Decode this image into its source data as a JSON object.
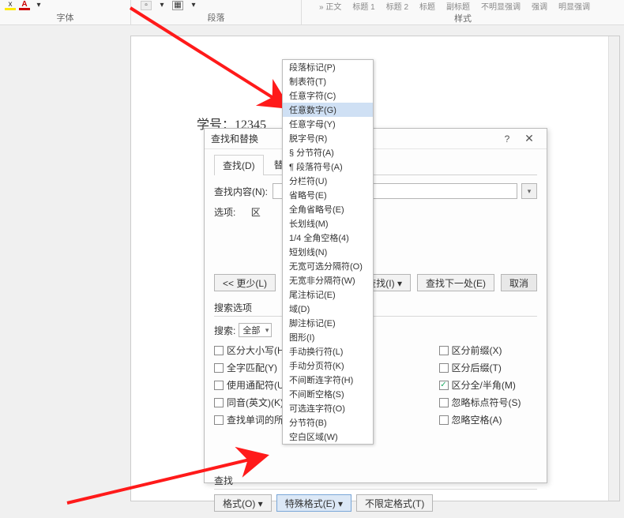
{
  "ribbon": {
    "font_group": "字体",
    "para_group": "段落",
    "style_group": "样式",
    "styles": [
      "» 正文",
      "标题 1",
      "标题 2",
      "标题",
      "副标题",
      "不明显强调",
      "强调",
      "明显强调"
    ]
  },
  "page": {
    "text": "学号：12345"
  },
  "dialog": {
    "title": "查找和替换",
    "help": "?",
    "close": "✕",
    "tabs": {
      "find": "查找(D)",
      "replace": "替换(P)"
    },
    "find_label": "查找内容(N):",
    "options_label": "选项:",
    "options_value": "区",
    "less_btn": "<< 更少(L)",
    "find_in_btn": "项中查找(I) ▾",
    "find_next_btn": "查找下一处(E)",
    "cancel_btn": "取消",
    "search_options_title": "搜索选项",
    "search_label": "搜索:",
    "search_scope": "全部",
    "chk_left": [
      "区分大小写(H)",
      "全字匹配(Y)",
      "使用通配符(U)",
      "同音(英文)(K)",
      "查找单词的所"
    ],
    "chk_right": [
      {
        "label": "区分前缀(X)",
        "checked": false
      },
      {
        "label": "区分后缀(T)",
        "checked": false
      },
      {
        "label": "区分全/半角(M)",
        "checked": true
      },
      {
        "label": "忽略标点符号(S)",
        "checked": false
      },
      {
        "label": "忽略空格(A)",
        "checked": false
      }
    ],
    "find_section": "查找",
    "format_btn": "格式(O) ▾",
    "special_btn": "特殊格式(E) ▾",
    "noformat_btn": "不限定格式(T)"
  },
  "dropdown": {
    "items": [
      "段落标记(P)",
      "制表符(T)",
      "任意字符(C)",
      "任意数字(G)",
      "任意字母(Y)",
      "脱字号(R)",
      "§ 分节符(A)",
      "¶ 段落符号(A)",
      "分栏符(U)",
      "省略号(E)",
      "全角省略号(E)",
      "长划线(M)",
      "1/4 全角空格(4)",
      "短划线(N)",
      "无宽可选分隔符(O)",
      "无宽非分隔符(W)",
      "尾注标记(E)",
      "域(D)",
      "脚注标记(E)",
      "图形(I)",
      "手动换行符(L)",
      "手动分页符(K)",
      "不间断连字符(H)",
      "不间断空格(S)",
      "可选连字符(O)",
      "分节符(B)",
      "空白区域(W)"
    ],
    "highlight_index": 3
  }
}
